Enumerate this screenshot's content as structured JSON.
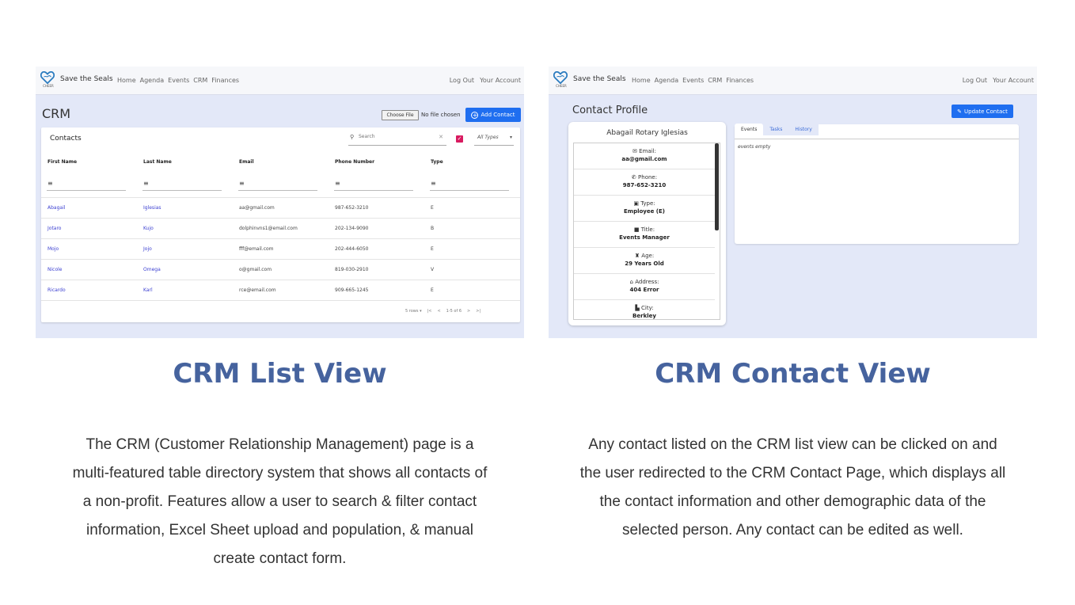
{
  "list_view": {
    "nav": {
      "logo_text": "CHEER",
      "brand": "Save the Seals",
      "links": [
        "Home",
        "Agenda",
        "Events",
        "CRM",
        "Finances"
      ],
      "right": [
        "Log Out",
        "Your Account"
      ]
    },
    "page_title": "CRM",
    "choose_file_label": "Choose File",
    "file_status": "No file chosen",
    "add_contact_label": "Add Contact",
    "panel_title": "Contacts",
    "search_placeholder": "Search",
    "type_filter": "All Types",
    "columns": [
      "First Name",
      "Last Name",
      "Email",
      "Phone Number",
      "Type"
    ],
    "rows": [
      [
        "Abagail",
        "Iglesias",
        "aa@gmail.com",
        "987-652-3210",
        "E"
      ],
      [
        "Jotaro",
        "Kujo",
        "dolphinvns1@email.com",
        "202-134-9090",
        "B"
      ],
      [
        "Mojo",
        "Jojo",
        "fff@email.com",
        "202-444-6050",
        "E"
      ],
      [
        "Nicole",
        "Omega",
        "o@gmail.com",
        "819-030-2910",
        "V"
      ],
      [
        "Ricardo",
        "Karl",
        "rce@email.com",
        "909-665-1245",
        "E"
      ]
    ],
    "pager": {
      "rows_per_page": "5 rows",
      "range": "1-5 of 6"
    }
  },
  "contact_view": {
    "nav": {
      "logo_text": "CHEER",
      "brand": "Save the Seals",
      "links": [
        "Home",
        "Agenda",
        "Events",
        "CRM",
        "Finances"
      ],
      "right": [
        "Log Out",
        "Your Account"
      ]
    },
    "page_title": "Contact Profile",
    "update_label": "Update Contact",
    "contact_name": "Abagail Rotary Iglesias",
    "fields": [
      {
        "icon": "envelope-icon",
        "glyph": "✉",
        "label": "Email:",
        "value": "aa@gmail.com"
      },
      {
        "icon": "phone-icon",
        "glyph": "✆",
        "label": "Phone:",
        "value": "987-652-3210"
      },
      {
        "icon": "id-badge-icon",
        "glyph": "▣",
        "label": "Type:",
        "value": "Employee (E)"
      },
      {
        "icon": "briefcase-icon",
        "glyph": "■",
        "label": "Title:",
        "value": "Events Manager"
      },
      {
        "icon": "cake-icon",
        "glyph": "♜",
        "label": "Age:",
        "value": "29 Years Old"
      },
      {
        "icon": "home-icon",
        "glyph": "⌂",
        "label": "Address:",
        "value": "404 Error"
      },
      {
        "icon": "city-icon",
        "glyph": "▙",
        "label": "City:",
        "value": "Berkley"
      }
    ],
    "tabs": [
      "Events",
      "Tasks",
      "History"
    ],
    "tab_content": "events empty"
  },
  "captions": {
    "list": "CRM List View",
    "contact": "CRM Contact View"
  },
  "descriptions": {
    "list": [
      "The CRM (Customer Relationship Management) page is a",
      "multi-featured table directory system that shows all contacts of",
      "a non-profit. Features allow a user to search & filter contact",
      "information, Excel Sheet upload and population, & manual",
      "create contact form."
    ],
    "contact": [
      "Any contact listed on the CRM list view can be clicked on and",
      "the user redirected to the CRM Contact Page, which displays all",
      "the contact information and other demographic data of the",
      "selected person. Any contact can be edited as well."
    ]
  },
  "colors": {
    "accent_blue": "#1f6ef0",
    "caption_blue": "#46639e",
    "checkbox_pink": "#d81b60",
    "background": "#e3e8f8"
  }
}
